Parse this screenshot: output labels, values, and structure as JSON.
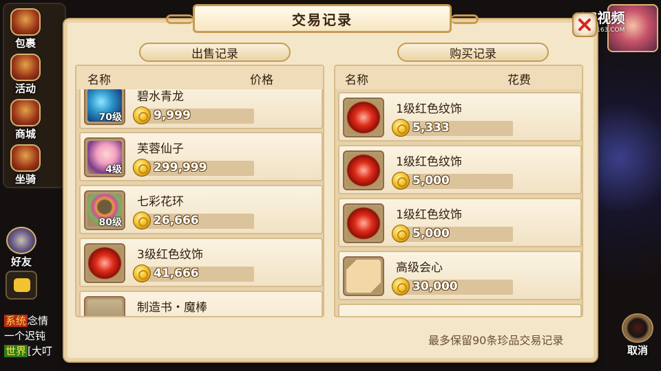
{
  "backdrop": {
    "left_menu": [
      {
        "label": "包裹",
        "icon": "bag-icon"
      },
      {
        "label": "活动",
        "icon": "horn-icon"
      },
      {
        "label": "商城",
        "icon": "shop-icon"
      },
      {
        "label": "坐骑",
        "icon": "mount-icon"
      }
    ],
    "friends_label": "好友",
    "chat": [
      {
        "tag": "系统",
        "text": "念情"
      },
      {
        "tag": "",
        "text": "一个迟钝"
      },
      {
        "tag": "世界",
        "text": "[大叮"
      }
    ],
    "cancel_label": "取消",
    "watermark": "CC视频",
    "watermark_sub": "CC.163.COM"
  },
  "modal": {
    "title": "交易记录",
    "close_icon": "close-icon",
    "sell": {
      "header": "出售记录",
      "col_name": "名称",
      "col_price": "价格",
      "items": [
        {
          "name": "碧水青龙",
          "price": "9,999",
          "level": "70级",
          "art": "dragon"
        },
        {
          "name": "芙蓉仙子",
          "price": "299,999",
          "level": "4级",
          "art": "fairy"
        },
        {
          "name": "七彩花环",
          "price": "26,666",
          "level": "80级",
          "art": "wreath"
        },
        {
          "name": "3级红色纹饰",
          "price": "41,666",
          "level": "",
          "art": "gem"
        },
        {
          "name": "制造书・魔棒",
          "price": "",
          "level": "",
          "art": "book"
        }
      ]
    },
    "buy": {
      "header": "购买记录",
      "col_name": "名称",
      "col_cost": "花费",
      "items": [
        {
          "name": "1级红色纹饰",
          "price": "5,333",
          "art": "gem"
        },
        {
          "name": "1级红色纹饰",
          "price": "5,000",
          "art": "gem"
        },
        {
          "name": "1级红色纹饰",
          "price": "5,000",
          "art": "gem"
        },
        {
          "name": "高级会心",
          "price": "30,000",
          "art": "scroll"
        }
      ]
    },
    "footer_note": "最多保留90条珍品交易记录"
  }
}
